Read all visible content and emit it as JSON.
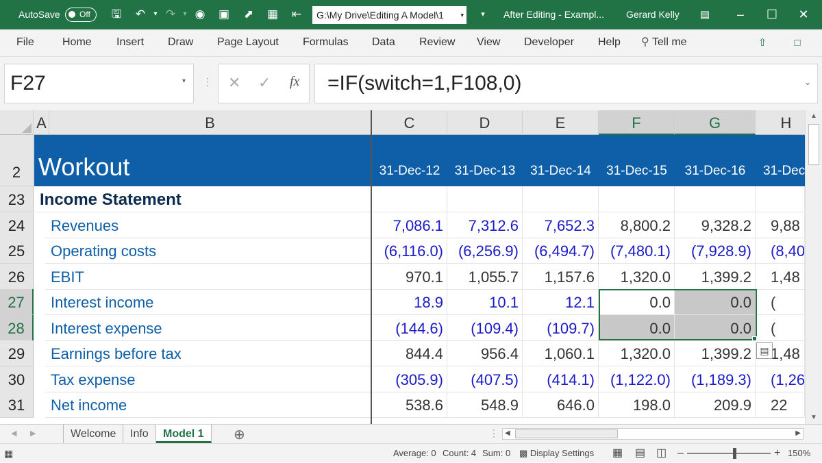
{
  "titlebar": {
    "autosave_label": "AutoSave",
    "autosave_state": "Off",
    "path": "G:\\My Drive\\Editing A Model\\1",
    "doc_title": "After Editing - Exampl...",
    "user": "Gerard Kelly",
    "icons": [
      "save-icon",
      "undo-icon",
      "redo-icon",
      "camera-icon",
      "screenshot-icon",
      "select-icon",
      "calculator-icon",
      "exit-icon",
      "ribbon-display-icon",
      "minimize-icon",
      "maximize-icon",
      "close-icon"
    ]
  },
  "ribbon": {
    "tabs": [
      "File",
      "Home",
      "Insert",
      "Draw",
      "Page Layout",
      "Formulas",
      "Data",
      "Review",
      "View",
      "Developer",
      "Help"
    ],
    "tell_me": "Tell me"
  },
  "formula_bar": {
    "name_box": "F27",
    "fx": "fx",
    "formula": "=IF(switch=1,F108,0)"
  },
  "columns": [
    "A",
    "B",
    "C",
    "D",
    "E",
    "F",
    "G",
    "H"
  ],
  "header_row": {
    "row_num": "2",
    "title": "Workout",
    "dates": [
      "31-Dec-12",
      "31-Dec-13",
      "31-Dec-14",
      "31-Dec-15",
      "31-Dec-16",
      "31-Dec"
    ]
  },
  "rows": [
    {
      "num": "23",
      "label": "Income Statement",
      "values": [
        "",
        "",
        "",
        "",
        "",
        ""
      ]
    },
    {
      "num": "24",
      "label": "Revenues",
      "values": [
        "7,086.1",
        "7,312.6",
        "7,652.3",
        "8,800.2",
        "9,328.2",
        "9,88"
      ]
    },
    {
      "num": "25",
      "label": "Operating costs",
      "values": [
        "(6,116.0)",
        "(6,256.9)",
        "(6,494.7)",
        "(7,480.1)",
        "(7,928.9)",
        "(8,40"
      ]
    },
    {
      "num": "26",
      "label": "EBIT",
      "values": [
        "970.1",
        "1,055.7",
        "1,157.6",
        "1,320.0",
        "1,399.2",
        "1,48"
      ]
    },
    {
      "num": "27",
      "label": "Interest income",
      "values": [
        "18.9",
        "10.1",
        "12.1",
        "0.0",
        "0.0",
        "("
      ]
    },
    {
      "num": "28",
      "label": "Interest expense",
      "values": [
        "(144.6)",
        "(109.4)",
        "(109.7)",
        "0.0",
        "0.0",
        "("
      ]
    },
    {
      "num": "29",
      "label": "Earnings before tax",
      "values": [
        "844.4",
        "956.4",
        "1,060.1",
        "1,320.0",
        "1,399.2",
        "1,48"
      ]
    },
    {
      "num": "30",
      "label": "Tax expense",
      "values": [
        "(305.9)",
        "(407.5)",
        "(414.1)",
        "(1,122.0)",
        "(1,189.3)",
        "(1,26"
      ]
    },
    {
      "num": "31",
      "label": "Net income",
      "values": [
        "538.6",
        "548.9",
        "646.0",
        "198.0",
        "209.9",
        "22"
      ]
    }
  ],
  "sheet_tabs": [
    "Welcome",
    "Info",
    "Model 1"
  ],
  "active_sheet": "Model 1",
  "status": {
    "average": "Average: 0",
    "count": "Count: 4",
    "sum": "Sum: 0",
    "display_settings": "Display Settings",
    "zoom": "150%"
  },
  "colors": {
    "excel_green": "#217346",
    "banner_blue": "#0f5fa8",
    "input_blue": "#1a1ac8",
    "label_blue": "#0b3b72"
  }
}
